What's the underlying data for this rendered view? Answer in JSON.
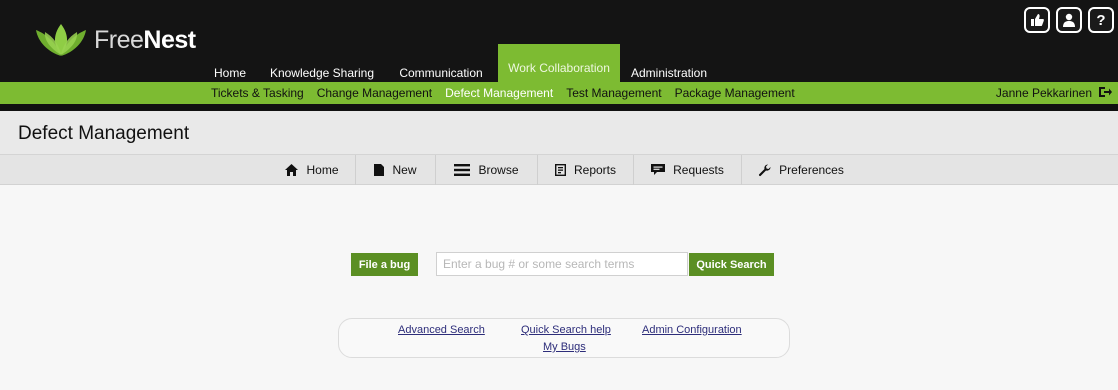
{
  "brand": {
    "light": "Free",
    "bold": "Nest"
  },
  "top_nav": [
    {
      "label": "Home",
      "active": false
    },
    {
      "label": "Knowledge Sharing",
      "active": false
    },
    {
      "label": "Communication",
      "active": false
    },
    {
      "label": "Work Collaboration",
      "active": true
    },
    {
      "label": "Administration",
      "active": false
    }
  ],
  "corner_icons": [
    "thumbs-up-icon",
    "user-badge-icon",
    "help-icon"
  ],
  "corner_glyphs": {
    "help": "?"
  },
  "sub_nav": [
    {
      "label": "Tickets & Tasking",
      "active": false
    },
    {
      "label": "Change Management",
      "active": false
    },
    {
      "label": "Defect Management",
      "active": true
    },
    {
      "label": "Test Management",
      "active": false
    },
    {
      "label": "Package Management",
      "active": false
    }
  ],
  "user": {
    "name": "Janne Pekkarinen"
  },
  "page_title": "Defect Management",
  "toolbar": [
    {
      "label": "Home",
      "icon": "home-icon"
    },
    {
      "label": "New",
      "icon": "new-document-icon"
    },
    {
      "label": "Browse",
      "icon": "browse-list-icon"
    },
    {
      "label": "Reports",
      "icon": "reports-icon"
    },
    {
      "label": "Requests",
      "icon": "requests-icon"
    },
    {
      "label": "Preferences",
      "icon": "wrench-icon"
    }
  ],
  "search": {
    "file_bug_label": "File a bug",
    "placeholder": "Enter a bug # or some search terms",
    "value": "",
    "quick_search_label": "Quick Search"
  },
  "links": {
    "advanced_search": "Advanced Search",
    "quick_search_help": "Quick Search help",
    "admin_configuration": "Admin Configuration",
    "my_bugs": "My Bugs"
  },
  "colors": {
    "accent_green": "#7dbb32",
    "button_green": "#5b8f23",
    "top_bar": "#141414"
  }
}
